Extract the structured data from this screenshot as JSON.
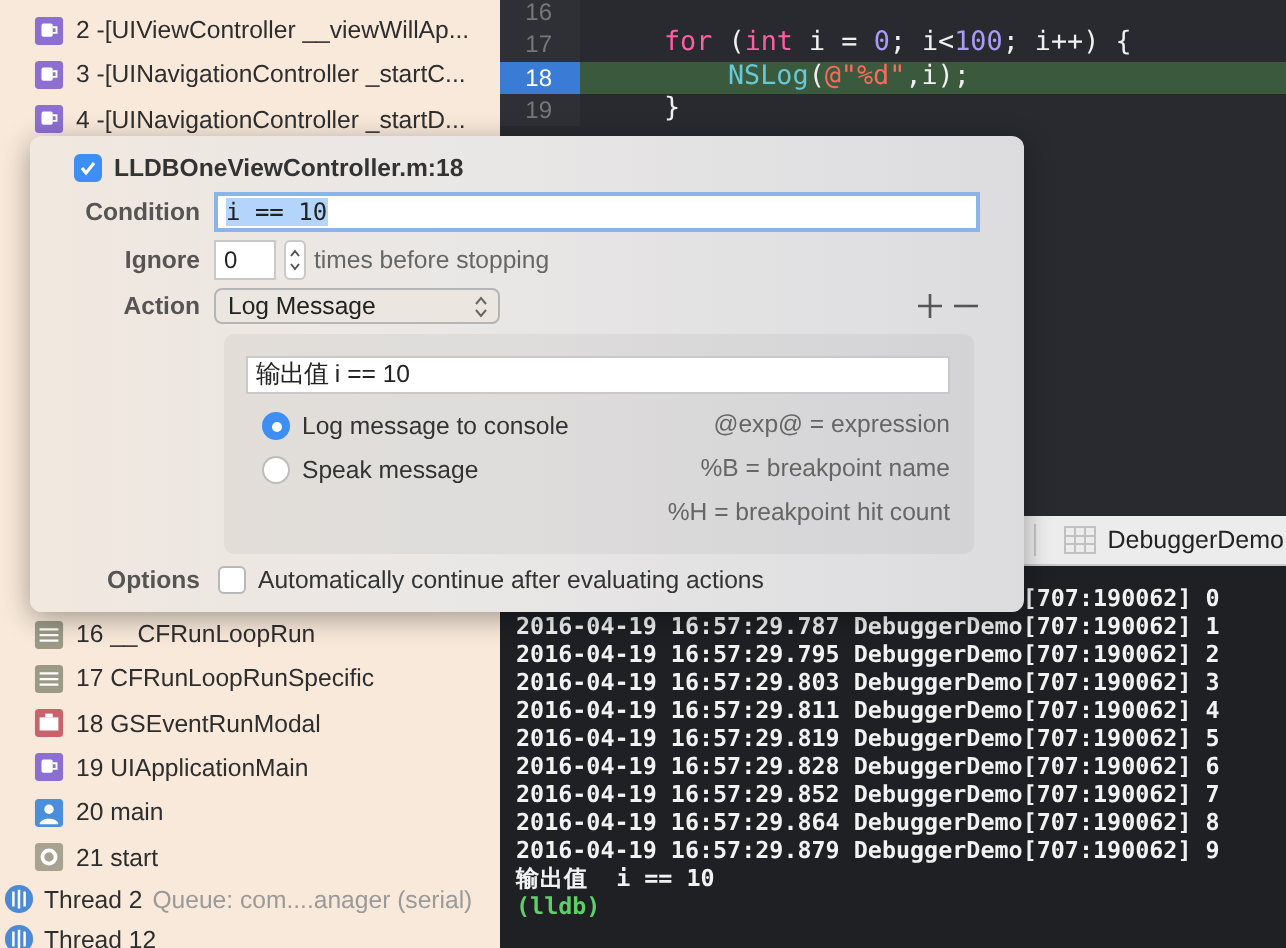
{
  "navigator": {
    "top_frames": [
      {
        "kind": "cup",
        "label": "2 -[UIViewController __viewWillAp..."
      },
      {
        "kind": "cup",
        "label": "3 -[UINavigationController _startC..."
      },
      {
        "kind": "cup",
        "label": "4 -[UINavigationController _startD..."
      }
    ],
    "frames": [
      {
        "kind": "list",
        "label": "16 __CFRunLoopRun"
      },
      {
        "kind": "list",
        "label": "17 CFRunLoopRunSpecific"
      },
      {
        "kind": "case",
        "label": "18 GSEventRunModal"
      },
      {
        "kind": "cup",
        "label": "19 UIApplicationMain"
      },
      {
        "kind": "person",
        "label": "20 main"
      },
      {
        "kind": "gear",
        "label": "21 start"
      }
    ],
    "threads": [
      {
        "label": "Thread 2",
        "detail": "Queue: com....anager (serial)"
      },
      {
        "label": "Thread 12"
      }
    ]
  },
  "editor": {
    "lines": [
      {
        "number": "16",
        "current": false
      },
      {
        "number": "17",
        "current": false,
        "kind": "outer",
        "tokens": [
          {
            "text": "for",
            "kind": "keyword"
          },
          {
            "text": " (",
            "kind": "plain"
          },
          {
            "text": "int",
            "kind": "keyword"
          },
          {
            "text": " i = ",
            "kind": "plain"
          },
          {
            "text": "0",
            "kind": "number"
          },
          {
            "text": "; i<",
            "kind": "plain"
          },
          {
            "text": "100",
            "kind": "number"
          },
          {
            "text": "; i++) {",
            "kind": "plain"
          }
        ]
      },
      {
        "number": "18",
        "current": true,
        "kind": "inner",
        "tokens": [
          {
            "text": "NSLog",
            "kind": "function"
          },
          {
            "text": "(",
            "kind": "plain"
          },
          {
            "text": "@\"%d\"",
            "kind": "string"
          },
          {
            "text": ",i);",
            "kind": "plain"
          }
        ]
      },
      {
        "number": "19",
        "current": false,
        "kind": "outer",
        "tokens": [
          {
            "text": "}",
            "kind": "plain"
          }
        ]
      }
    ]
  },
  "console": {
    "target": "DebuggerDemo",
    "lines": [
      {
        "kind": "partial",
        "text": "[707:190062] 0"
      },
      {
        "kind": "log",
        "text": "2016-04-19 16:57:29.787 DebuggerDemo[707:190062] 1"
      },
      {
        "kind": "log",
        "text": "2016-04-19 16:57:29.795 DebuggerDemo[707:190062] 2"
      },
      {
        "kind": "log",
        "text": "2016-04-19 16:57:29.803 DebuggerDemo[707:190062] 3"
      },
      {
        "kind": "log",
        "text": "2016-04-19 16:57:29.811 DebuggerDemo[707:190062] 4"
      },
      {
        "kind": "log",
        "text": "2016-04-19 16:57:29.819 DebuggerDemo[707:190062] 5"
      },
      {
        "kind": "log",
        "text": "2016-04-19 16:57:29.828 DebuggerDemo[707:190062] 6"
      },
      {
        "kind": "log",
        "text": "2016-04-19 16:57:29.852 DebuggerDemo[707:190062] 7"
      },
      {
        "kind": "log",
        "text": "2016-04-19 16:57:29.864 DebuggerDemo[707:190062] 8"
      },
      {
        "kind": "log",
        "text": "2016-04-19 16:57:29.879 DebuggerDemo[707:190062] 9"
      },
      {
        "kind": "log",
        "text": "输出值  i == 10"
      },
      {
        "kind": "prompt",
        "text": "(lldb)"
      }
    ]
  },
  "breakpoint": {
    "enabled": true,
    "title": "LLDBOneViewController.m:18",
    "condition_label": "Condition",
    "condition": "i == 10",
    "ignore_label": "Ignore",
    "ignore": "0",
    "ignore_suffix": "times before stopping",
    "action_label": "Action",
    "action": "Log Message",
    "message": "输出值 i == 10",
    "outputs": [
      {
        "label": "Log message to console",
        "selected": true
      },
      {
        "label": "Speak message",
        "selected": false
      }
    ],
    "hints": [
      "@exp@ = expression",
      "%B = breakpoint name",
      "%H = breakpoint hit count"
    ],
    "options_label": "Options",
    "auto_continue": false,
    "auto_continue_label": "Automatically continue after evaluating actions"
  }
}
